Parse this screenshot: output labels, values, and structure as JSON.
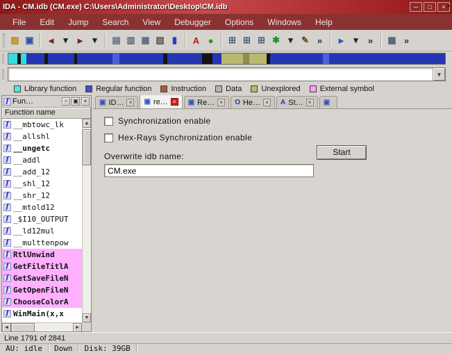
{
  "window": {
    "title": "IDA - CM.idb (CM.exe) C:\\Users\\Administrator\\Desktop\\CM.idb",
    "buttons": {
      "minimize": "─",
      "maximize": "□",
      "close": "×"
    }
  },
  "menu": {
    "items": [
      {
        "label": "File",
        "n": "menu-file"
      },
      {
        "label": "Edit",
        "n": "menu-edit"
      },
      {
        "label": "Jump",
        "n": "menu-jump"
      },
      {
        "label": "Search",
        "n": "menu-search"
      },
      {
        "label": "View",
        "n": "menu-view"
      },
      {
        "label": "Debugger",
        "n": "menu-debugger"
      },
      {
        "label": "Options",
        "n": "menu-options"
      },
      {
        "label": "Windows",
        "n": "menu-windows"
      },
      {
        "label": "Help",
        "n": "menu-help"
      }
    ]
  },
  "toolbar": {
    "items": [
      {
        "t": "handle",
        "n": "toolbar-drag-handle",
        "ia": "true"
      },
      {
        "t": "tbi",
        "n": "open-file-icon",
        "g": "▨",
        "c": "#b8860b",
        "ia": "true"
      },
      {
        "t": "tbi",
        "n": "save-icon",
        "g": "▣",
        "c": "#2f4fa0",
        "ia": "true"
      },
      {
        "t": "sep",
        "n": "toolbar-separator",
        "ia": "false"
      },
      {
        "t": "tbi",
        "n": "nav-back-icon",
        "g": "◄",
        "c": "#7a1f1f",
        "ia": "true"
      },
      {
        "t": "tbi",
        "n": "nav-back-menu-icon",
        "g": "▾",
        "c": "#222222",
        "ia": "true"
      },
      {
        "t": "tbi",
        "n": "nav-forward-icon",
        "g": "►",
        "c": "#7a1f1f",
        "ia": "true"
      },
      {
        "t": "tbi",
        "n": "nav-forward-menu-icon",
        "g": "▾",
        "c": "#222222",
        "ia": "true"
      },
      {
        "t": "sep",
        "n": "toolbar-separator",
        "ia": "false"
      },
      {
        "t": "tbi",
        "n": "jump-address-icon",
        "g": "▤",
        "c": "#5a6a7a",
        "ia": "true"
      },
      {
        "t": "tbi",
        "n": "jump-name-icon",
        "g": "▥",
        "c": "#5a6a7a",
        "ia": "true"
      },
      {
        "t": "tbi",
        "n": "jump-function-icon",
        "g": "▦",
        "c": "#5a6a7a",
        "ia": "true"
      },
      {
        "t": "tbi",
        "n": "print-icon",
        "g": "▧",
        "c": "#55524c",
        "ia": "true"
      },
      {
        "t": "tbi",
        "n": "navigator-icon",
        "g": "▮",
        "c": "#2840c0",
        "ia": "true"
      },
      {
        "t": "sep",
        "n": "toolbar-separator",
        "ia": "false"
      },
      {
        "t": "tbi",
        "n": "text-search-icon",
        "g": "A",
        "c": "#c01818",
        "ia": "true"
      },
      {
        "t": "tbi",
        "n": "debugger-enable-icon",
        "g": "●",
        "c": "#1f9e1f",
        "ia": "true"
      },
      {
        "t": "sep",
        "n": "toolbar-separator",
        "ia": "false"
      },
      {
        "t": "tbi",
        "n": "add-breakpoint-icon",
        "g": "⊞",
        "c": "#4a6078",
        "ia": "true"
      },
      {
        "t": "tbi",
        "n": "add-watch-icon",
        "g": "⊞",
        "c": "#4a6078",
        "ia": "true"
      },
      {
        "t": "tbi",
        "n": "run-until-icon",
        "g": "⊞",
        "c": "#4a6078",
        "ia": "true"
      },
      {
        "t": "tbi",
        "n": "new-snapshot-icon",
        "g": "✱",
        "c": "#1f8f1f",
        "ia": "true"
      },
      {
        "t": "tbi",
        "n": "snapshot-menu-icon",
        "g": "▾",
        "c": "#222222",
        "ia": "true"
      },
      {
        "t": "tbi",
        "n": "edit-icon",
        "g": "✎",
        "c": "#6a4a20",
        "ia": "true"
      },
      {
        "t": "tbi",
        "n": "more-tools-icon",
        "g": "»",
        "c": "#333333",
        "ia": "true"
      },
      {
        "t": "sep",
        "n": "toolbar-separator",
        "ia": "false"
      },
      {
        "t": "tbi",
        "n": "run-icon",
        "g": "►",
        "c": "#2858c0",
        "ia": "true"
      },
      {
        "t": "tbi",
        "n": "run-menu-icon",
        "g": "▾",
        "c": "#222222",
        "ia": "true"
      },
      {
        "t": "tbi",
        "n": "more-run-icon",
        "g": "»",
        "c": "#333333",
        "ia": "true"
      },
      {
        "t": "sep",
        "n": "toolbar-separator",
        "ia": "false"
      },
      {
        "t": "tbi",
        "n": "windows-icon",
        "g": "▦",
        "c": "#4a6078",
        "ia": "true"
      },
      {
        "t": "tbi",
        "n": "more-windows-icon",
        "g": "»",
        "c": "#333333",
        "ia": "true"
      }
    ]
  },
  "nav_band": {
    "segments": [
      {
        "c": "#35dcdc",
        "w": "2%"
      },
      {
        "c": "#141414",
        "w": "0.8%"
      },
      {
        "c": "#35dcdc",
        "w": "1.4%"
      },
      {
        "c": "#2536b4",
        "w": "4%"
      },
      {
        "c": "#141414",
        "w": "0.9%"
      },
      {
        "c": "#2536b4",
        "w": "6%"
      },
      {
        "c": "#141414",
        "w": "0.7%"
      },
      {
        "c": "#2536b4",
        "w": "8%"
      },
      {
        "c": "#4c60d8",
        "w": "1.6%"
      },
      {
        "c": "#2536b4",
        "w": "10%"
      },
      {
        "c": "#141414",
        "w": "1%"
      },
      {
        "c": "#2536b4",
        "w": "8%"
      },
      {
        "c": "#141414",
        "w": "2.4%"
      },
      {
        "c": "#2536b4",
        "w": "2%"
      },
      {
        "c": "#b9b972",
        "w": "5%"
      },
      {
        "c": "#8d8d4e",
        "w": "1.4%"
      },
      {
        "c": "#b9b972",
        "w": "4%"
      },
      {
        "c": "#141414",
        "w": "0.8%"
      },
      {
        "c": "#2536b4",
        "w": "12%"
      },
      {
        "c": "#4c60d8",
        "w": "1.5%"
      },
      {
        "c": "#2536b4",
        "w": "26.5%"
      }
    ]
  },
  "combo": {
    "value": "",
    "arrow": "▼"
  },
  "legend": {
    "items": [
      {
        "label": "Library function",
        "color": "#52e8e8"
      },
      {
        "label": "Regular function",
        "color": "#3c50c8"
      },
      {
        "label": "Instruction",
        "color": "#a85a3c"
      },
      {
        "label": "Data",
        "color": "#b4b4b4"
      },
      {
        "label": "Unexplored",
        "color": "#b8b868"
      },
      {
        "label": "External symbol",
        "color": "#ff9cff"
      }
    ]
  },
  "funcpanel": {
    "title": "Fun…",
    "header": "Function name",
    "buttons": {
      "restore": "▫",
      "float": "▣",
      "close": "×"
    }
  },
  "functions": {
    "icon_glyph": "f",
    "items": [
      {
        "label": "__mbtowc_lk"
      },
      {
        "label": "__allshl"
      },
      {
        "label": "__ungetc",
        "cls": "b"
      },
      {
        "label": "__addl"
      },
      {
        "label": "__add_12"
      },
      {
        "label": "__shl_12"
      },
      {
        "label": "__shr_12"
      },
      {
        "label": "__mtold12"
      },
      {
        "label": "_$I10_OUTPUT"
      },
      {
        "label": "__ld12mul"
      },
      {
        "label": "__multtenpow"
      },
      {
        "label": "RtlUnwind",
        "cls": "ext"
      },
      {
        "label": "GetFileTitlA",
        "cls": "ext"
      },
      {
        "label": "GetSaveFileN",
        "cls": "ext"
      },
      {
        "label": "GetOpenFileN",
        "cls": "ext"
      },
      {
        "label": "ChooseColorA",
        "cls": "ext"
      },
      {
        "label": "WinMain(x,x",
        "cls": "b"
      }
    ]
  },
  "scroll": {
    "up": "▲",
    "down": "▼",
    "left": "◄",
    "right": "►"
  },
  "tabs": {
    "scroll_icon": "▸",
    "items": [
      {
        "n": "tab-ida-view",
        "label": "ID…",
        "icon": "▣",
        "ic": "#3a55c0",
        "close": "×"
      },
      {
        "n": "tab-re-tool",
        "label": "re…",
        "icon": "▣",
        "ic": "#3a55c0",
        "close": "×",
        "cls": "active"
      },
      {
        "n": "tab-rem",
        "label": "Re…",
        "icon": "▣",
        "ic": "#3a55c0",
        "close": "×"
      },
      {
        "n": "tab-hex-view",
        "label": "He…",
        "icon": "O",
        "ic": "#1a35c0",
        "close": "×"
      },
      {
        "n": "tab-strings",
        "label": "St…",
        "icon": "A",
        "ic": "#1a35c0",
        "close": "×"
      },
      {
        "n": "tab-partial",
        "label": "",
        "icon": "▣",
        "ic": "#3a55c0",
        "cls": "partial"
      }
    ]
  },
  "content": {
    "sync_label": "Synchronization enable",
    "sync_checked": false,
    "hexrays_label": "Hex-Rays Synchronization enable",
    "hexrays_checked": false,
    "overwrite_label": "Overwrite idb name:",
    "start_label": "Start",
    "idb_name": "CM.exe"
  },
  "statusline": {
    "text": "Line 1791 of 2841"
  },
  "statusbar": {
    "au": "AU: idle",
    "mode": "Down",
    "disk": "Disk: 39GB"
  }
}
